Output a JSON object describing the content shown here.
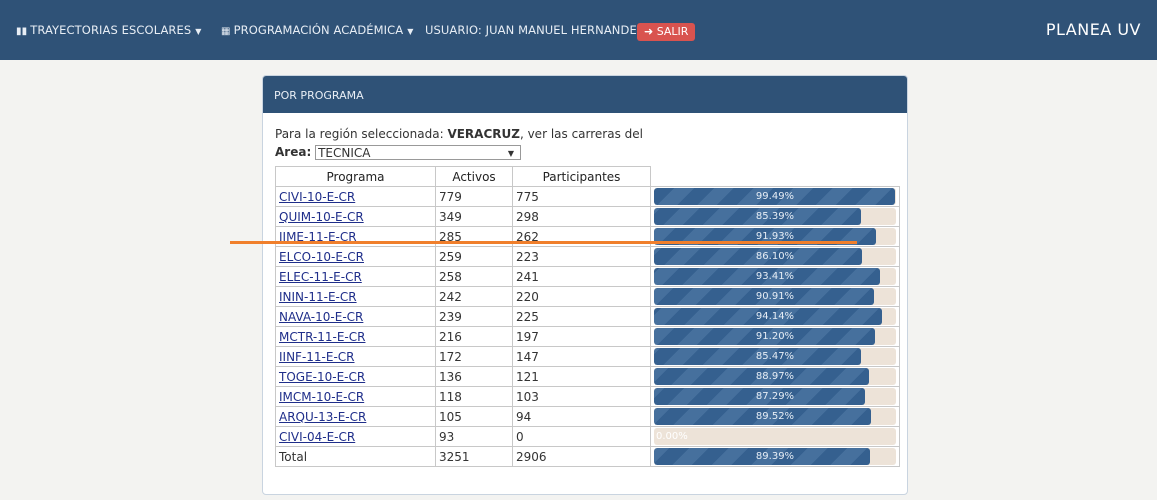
{
  "navbar": {
    "trayectorias": "TRAYECTORIAS ESCOLARES",
    "programacion": "PROGRAMACIÓN ACADÉMICA",
    "usuario": "USUARIO: JUAN MANUEL HERNANDEZ",
    "salir": "SALIR",
    "brand": "PLANEA UV"
  },
  "panel": {
    "title": "POR PROGRAMA",
    "intro_prefix": "Para la región seleccionada: ",
    "region": "VERACRUZ",
    "intro_suffix": ", ver las carreras del",
    "area_label": "Area:",
    "area_value": "TECNICA"
  },
  "table": {
    "headers": [
      "Programa",
      "Activos",
      "Participantes"
    ],
    "rows": [
      {
        "programa": "CIVI-10-E-CR",
        "activos": "779",
        "participantes": "775",
        "pct": "99.49%",
        "ratio": 0.9949
      },
      {
        "programa": "QUIM-10-E-CR",
        "activos": "349",
        "participantes": "298",
        "pct": "85.39%",
        "ratio": 0.8539
      },
      {
        "programa": "IIME-11-E-CR",
        "activos": "285",
        "participantes": "262",
        "pct": "91.93%",
        "ratio": 0.9193
      },
      {
        "programa": "ELCO-10-E-CR",
        "activos": "259",
        "participantes": "223",
        "pct": "86.10%",
        "ratio": 0.861
      },
      {
        "programa": "ELEC-11-E-CR",
        "activos": "258",
        "participantes": "241",
        "pct": "93.41%",
        "ratio": 0.9341
      },
      {
        "programa": "ININ-11-E-CR",
        "activos": "242",
        "participantes": "220",
        "pct": "90.91%",
        "ratio": 0.9091
      },
      {
        "programa": "NAVA-10-E-CR",
        "activos": "239",
        "participantes": "225",
        "pct": "94.14%",
        "ratio": 0.9414
      },
      {
        "programa": "MCTR-11-E-CR",
        "activos": "216",
        "participantes": "197",
        "pct": "91.20%",
        "ratio": 0.912
      },
      {
        "programa": "IINF-11-E-CR",
        "activos": "172",
        "participantes": "147",
        "pct": "85.47%",
        "ratio": 0.8547
      },
      {
        "programa": "TOGE-10-E-CR",
        "activos": "136",
        "participantes": "121",
        "pct": "88.97%",
        "ratio": 0.8897
      },
      {
        "programa": "IMCM-10-E-CR",
        "activos": "118",
        "participantes": "103",
        "pct": "87.29%",
        "ratio": 0.8729
      },
      {
        "programa": "ARQU-13-E-CR",
        "activos": "105",
        "participantes": "94",
        "pct": "89.52%",
        "ratio": 0.8952
      },
      {
        "programa": "CIVI-04-E-CR",
        "activos": "93",
        "participantes": "0",
        "pct": "0.00%",
        "ratio": 0.0
      }
    ],
    "total": {
      "label": "Total",
      "activos": "3251",
      "participantes": "2906",
      "pct": "89.39%",
      "ratio": 0.8939
    }
  },
  "colors": {
    "navbar": "#2f5277",
    "bar_fill": "#35608f",
    "bar_track": "#ede3d8",
    "salir": "#d9534f",
    "annotation_line": "#f07f2c"
  }
}
